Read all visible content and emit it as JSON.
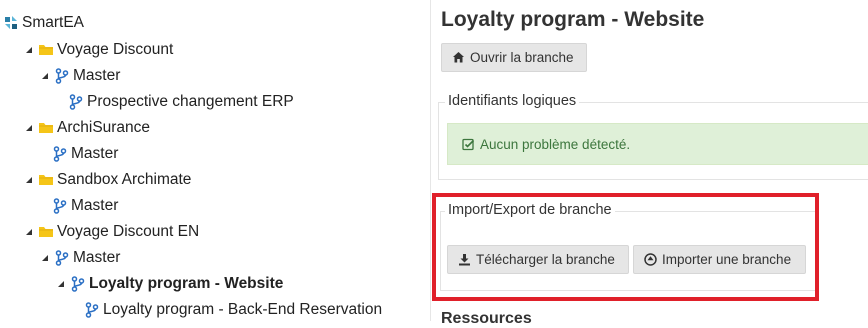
{
  "tree": {
    "root": "SmartEA",
    "nodes": [
      {
        "label": "Voyage Discount",
        "kind": "folder",
        "expanded": true
      },
      {
        "label": "Master",
        "kind": "branch",
        "expanded": true
      },
      {
        "label": "Prospective changement ERP",
        "kind": "branch"
      },
      {
        "label": "ArchiSurance",
        "kind": "folder",
        "expanded": true
      },
      {
        "label": "Master",
        "kind": "branch"
      },
      {
        "label": "Sandbox Archimate",
        "kind": "folder",
        "expanded": true
      },
      {
        "label": "Master",
        "kind": "branch"
      },
      {
        "label": "Voyage Discount EN",
        "kind": "folder",
        "expanded": true
      },
      {
        "label": "Master",
        "kind": "branch",
        "expanded": true
      },
      {
        "label": "Loyalty program - Website",
        "kind": "branch",
        "expanded": true,
        "selected": true
      },
      {
        "label": "Loyalty program - Back-End Reservation",
        "kind": "branch"
      }
    ]
  },
  "panel": {
    "title": "Loyalty program - Website",
    "open_branch_button": "Ouvrir la branche",
    "logical_ids_legend": "Identifiants logiques",
    "alert_text": "Aucun problème détecté.",
    "import_export_legend": "Import/Export de branche",
    "download_button": "Télécharger la branche",
    "import_button": "Importer une branche",
    "next_section_title": "Ressources"
  },
  "colors": {
    "folder": "#f5c518",
    "branch": "#2a6fc4",
    "alert_bg": "#dff0d8",
    "alert_text": "#3c763d",
    "highlight": "#e0202a",
    "logo": "#2a7fa8"
  },
  "icons": {
    "root": "smartea-logo-icon",
    "folder": "folder-icon",
    "branch": "branch-icon",
    "expanded": "caret-expanded-icon",
    "open": "home-icon",
    "check": "check-square-icon",
    "download": "download-icon",
    "import": "circle-arrow-icon"
  }
}
